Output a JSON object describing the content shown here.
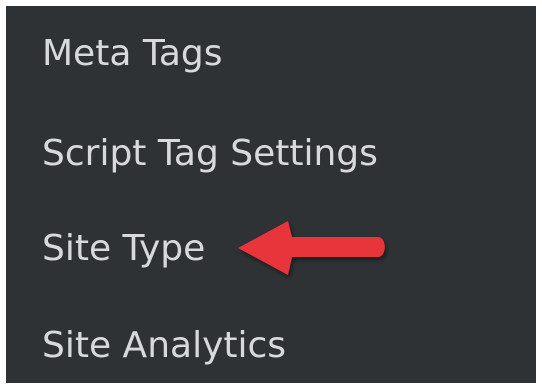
{
  "menu": {
    "items": [
      {
        "label": "Meta Tags"
      },
      {
        "label": "Script Tag Settings"
      },
      {
        "label": "Site Type"
      },
      {
        "label": "Site Analytics"
      }
    ]
  },
  "annotation": {
    "icon": "arrow-left-icon",
    "color": "#e8363b"
  },
  "colors": {
    "panel_background": "#2f3235",
    "item_text": "#d7d9db"
  }
}
